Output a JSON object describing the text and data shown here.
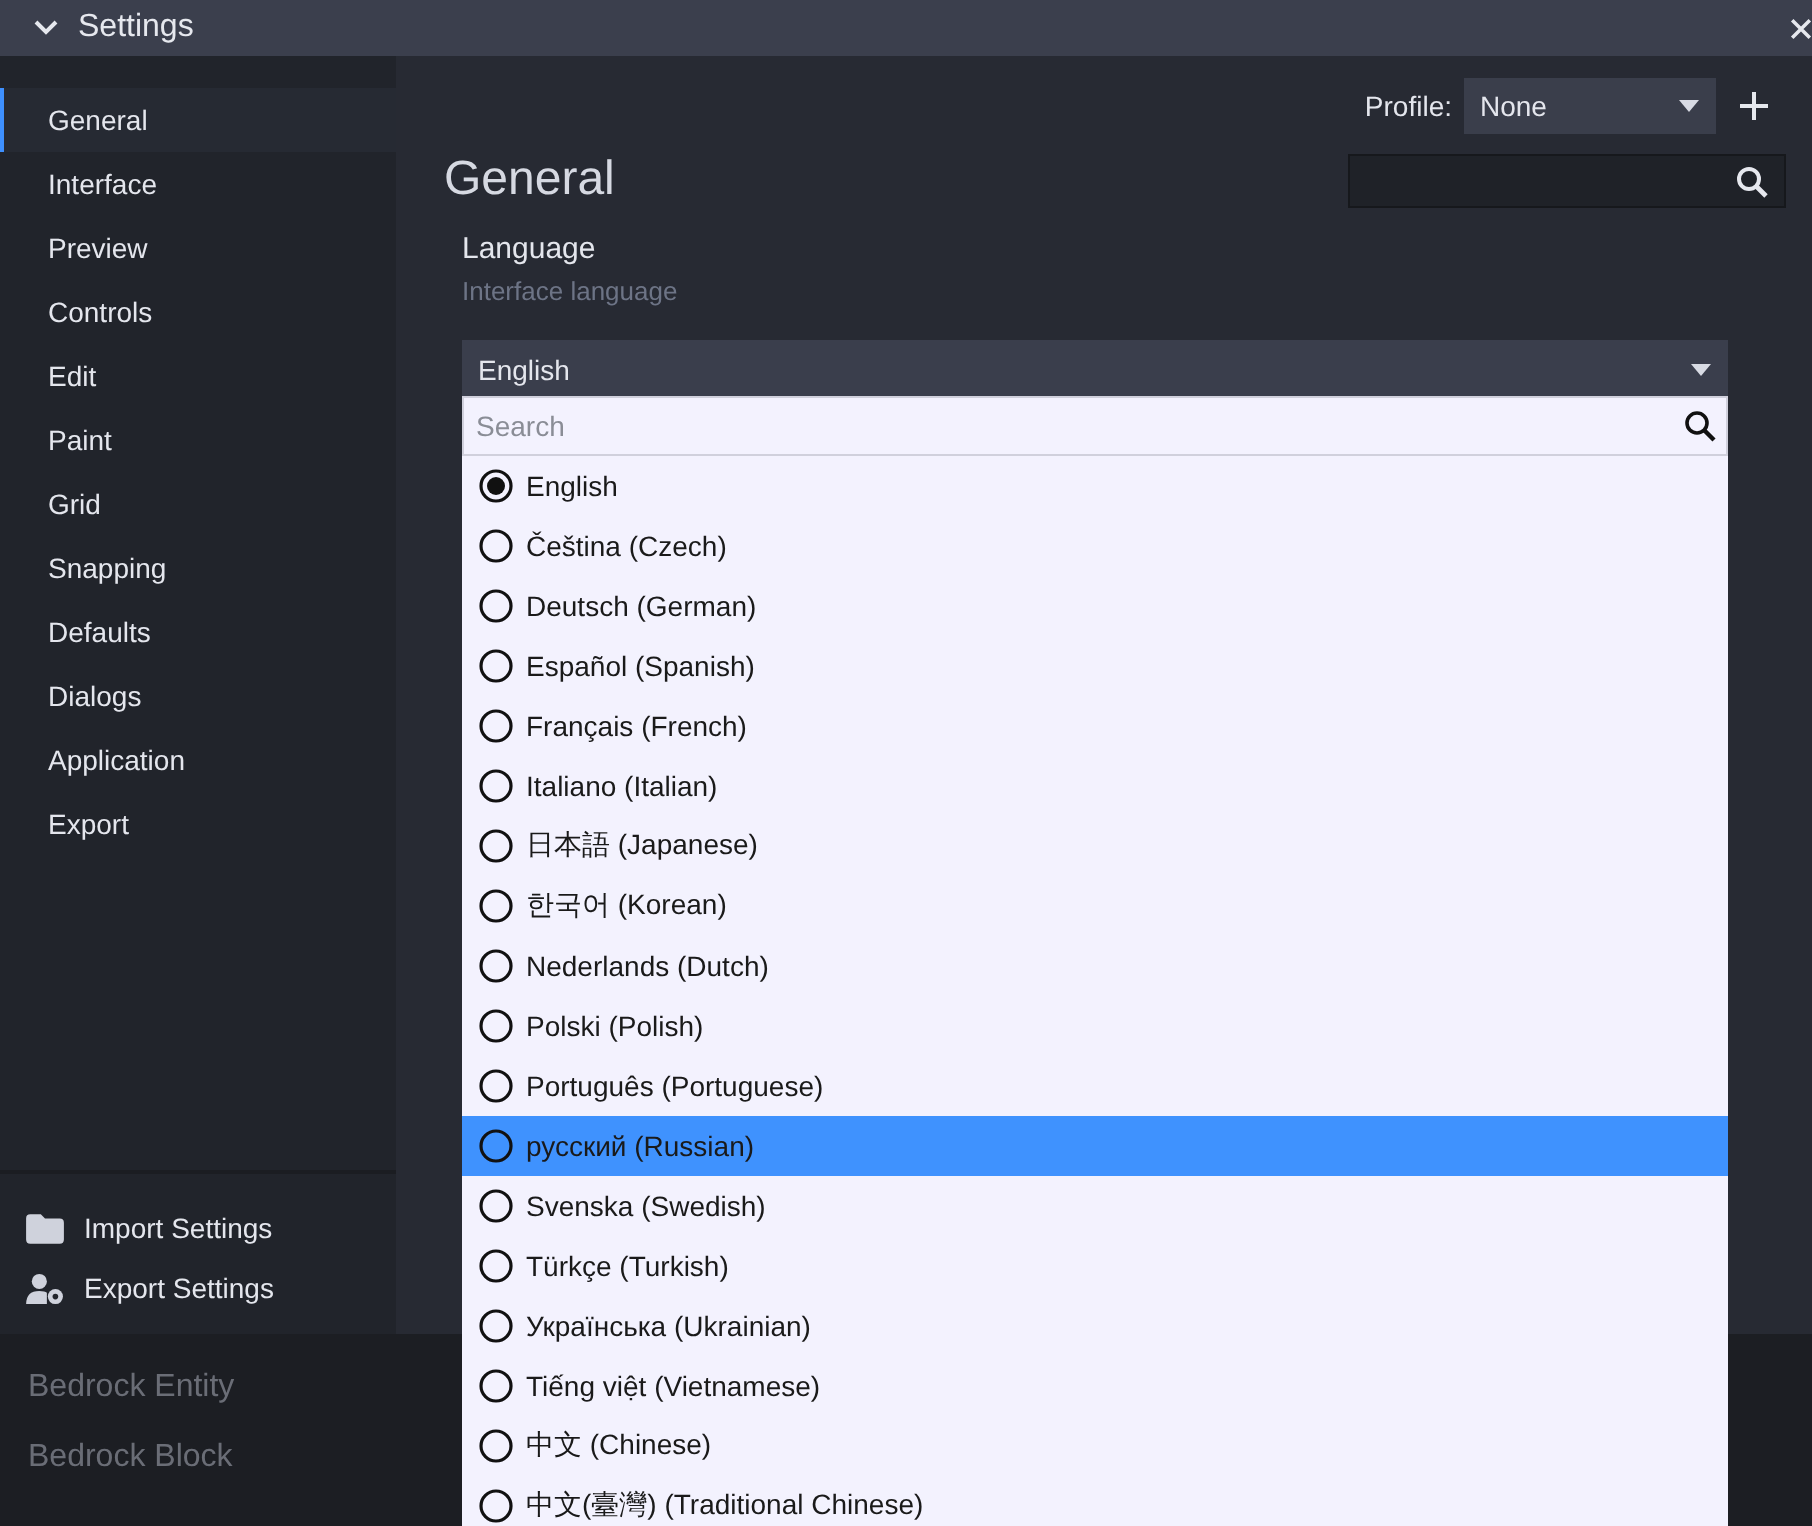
{
  "window": {
    "title": "Settings"
  },
  "sidebar": {
    "items": [
      {
        "label": "General",
        "selected": true
      },
      {
        "label": "Interface",
        "selected": false
      },
      {
        "label": "Preview",
        "selected": false
      },
      {
        "label": "Controls",
        "selected": false
      },
      {
        "label": "Edit",
        "selected": false
      },
      {
        "label": "Paint",
        "selected": false
      },
      {
        "label": "Grid",
        "selected": false
      },
      {
        "label": "Snapping",
        "selected": false
      },
      {
        "label": "Defaults",
        "selected": false
      },
      {
        "label": "Dialogs",
        "selected": false
      },
      {
        "label": "Application",
        "selected": false
      },
      {
        "label": "Export",
        "selected": false
      }
    ],
    "actions": [
      {
        "kind": "import",
        "label": "Import Settings"
      },
      {
        "kind": "export",
        "label": "Export Settings"
      }
    ]
  },
  "profile": {
    "label": "Profile:",
    "value": "None"
  },
  "heading": "General",
  "language": {
    "label": "Language",
    "description": "Interface language",
    "value": "English",
    "dropdown": {
      "placeholder": "Search",
      "options": [
        {
          "label": "English",
          "selected": true,
          "hovered": false
        },
        {
          "label": "Čeština (Czech)",
          "selected": false,
          "hovered": false
        },
        {
          "label": "Deutsch (German)",
          "selected": false,
          "hovered": false
        },
        {
          "label": "Español (Spanish)",
          "selected": false,
          "hovered": false
        },
        {
          "label": "Français (French)",
          "selected": false,
          "hovered": false
        },
        {
          "label": "Italiano (Italian)",
          "selected": false,
          "hovered": false
        },
        {
          "label": "日本語 (Japanese)",
          "selected": false,
          "hovered": false
        },
        {
          "label": "한국어 (Korean)",
          "selected": false,
          "hovered": false
        },
        {
          "label": "Nederlands (Dutch)",
          "selected": false,
          "hovered": false
        },
        {
          "label": "Polski (Polish)",
          "selected": false,
          "hovered": false
        },
        {
          "label": "Português (Portuguese)",
          "selected": false,
          "hovered": false
        },
        {
          "label": "русский (Russian)",
          "selected": false,
          "hovered": true
        },
        {
          "label": "Svenska (Swedish)",
          "selected": false,
          "hovered": false
        },
        {
          "label": "Türkçe (Turkish)",
          "selected": false,
          "hovered": false
        },
        {
          "label": "Українська (Ukrainian)",
          "selected": false,
          "hovered": false
        },
        {
          "label": "Tiếng việt (Vietnamese)",
          "selected": false,
          "hovered": false
        },
        {
          "label": "中文 (Chinese)",
          "selected": false,
          "hovered": false
        },
        {
          "label": "中文(臺灣) (Traditional Chinese)",
          "selected": false,
          "hovered": false
        }
      ]
    }
  },
  "background_items": [
    "Bedrock Entity",
    "Bedrock Block"
  ]
}
